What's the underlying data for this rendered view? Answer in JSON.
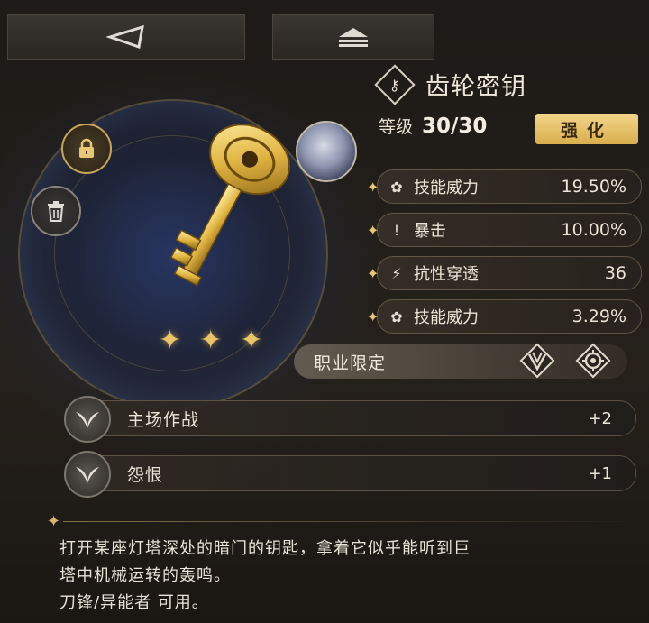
{
  "nav": {
    "back_icon": "back-triangle-icon",
    "up_icon": "collapse-up-icon"
  },
  "item": {
    "name": "齿轮密钥",
    "icon": "key-diamond-icon",
    "level_label": "等级",
    "level_value": "30/30",
    "enhance_label": "强化",
    "stars": 3
  },
  "stats": [
    {
      "icon": "skill-power-icon",
      "name": "技能威力",
      "value": "19.50%"
    },
    {
      "icon": "crit-icon",
      "name": "暴击",
      "value": "10.00%"
    },
    {
      "icon": "resist-pierce-icon",
      "name": "抗性穿透",
      "value": "36"
    },
    {
      "icon": "skill-power-icon",
      "name": "技能威力",
      "value": "3.29%"
    }
  ],
  "job": {
    "label": "职业限定",
    "icons": [
      "blade-class-icon",
      "esper-class-icon"
    ]
  },
  "skills": [
    {
      "icon": "wings-skill-icon",
      "name": "主场作战",
      "value": "+2"
    },
    {
      "icon": "wings-skill-icon",
      "name": "怨恨",
      "value": "+1"
    }
  ],
  "description": {
    "line1": "打开某座灯塔深处的暗门的钥匙，拿着它似乎能听到巨",
    "line2": "塔中机械运转的轰鸣。",
    "line3": "刀锋/异能者 可用。"
  },
  "colors": {
    "accent_gold": "#e8c677",
    "enhance_button": "#e9c46a",
    "background": "#1d1a17"
  }
}
